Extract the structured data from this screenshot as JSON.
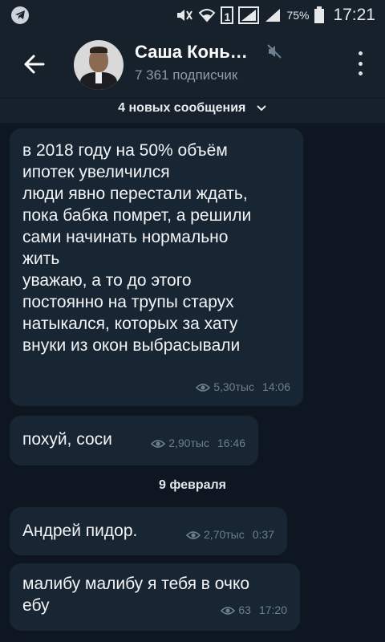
{
  "status_bar": {
    "battery": "75%",
    "time": "17:21",
    "sim": "1"
  },
  "header": {
    "title": "Саша Конь…",
    "subscribers": "7 361 подписчик"
  },
  "new_messages_bar": {
    "label": "4 новых сообщения"
  },
  "messages": [
    {
      "text": "в 2018 году на 50% объём\nипотек увеличился\nлюди явно перестали ждать,\nпока бабка помрет, а решили\nсами начинать нормально\nжить\nуважаю, а то до этого\nпостоянно на трупы старух\nнатыкался, которых за хату\nвнуки из окон выбрасывали",
      "views": "5,30тыс",
      "time": "14:06"
    },
    {
      "text": "похуй, соси",
      "views": "2,90тыс",
      "time": "16:46"
    },
    {
      "text": "Андрей пидор.",
      "views": "2,70тыс",
      "time": "0:37"
    },
    {
      "text": "малибу малибу я тебя в очко\nебу",
      "views": "63",
      "time": "17:20"
    }
  ],
  "date_separator": "9 февраля",
  "colors": {
    "background": "#0e1621",
    "header": "#17212b",
    "bubble": "#182533",
    "meta": "#6d7f8f"
  }
}
